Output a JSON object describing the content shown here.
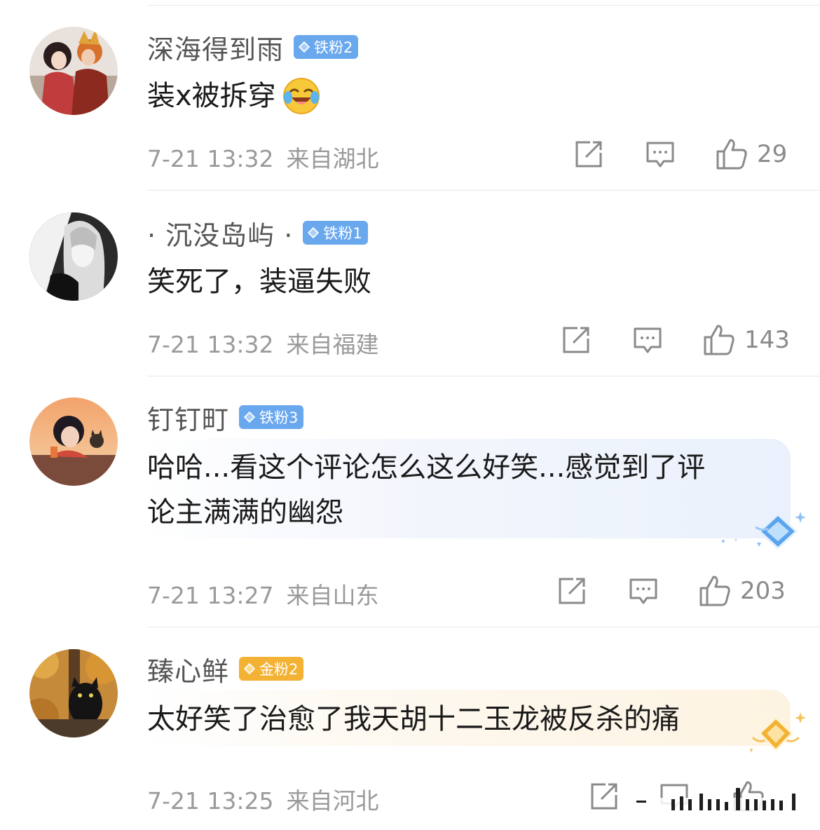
{
  "comments": [
    {
      "username": "深海得到雨",
      "badge": "铁粉2",
      "badge_type": "iron",
      "text": "装x被拆穿",
      "emoji": "laugh-cry-icon",
      "time": "7-21 13:32",
      "location": "来自湖北",
      "likes": "29"
    },
    {
      "username": "· 沉没岛屿 ·",
      "badge": "铁粉1",
      "badge_type": "iron",
      "text": "笑死了，装逼失败",
      "time": "7-21 13:32",
      "location": "来自福建",
      "likes": "143"
    },
    {
      "username": "钉钉町",
      "badge": "铁粉3",
      "badge_type": "iron",
      "text_line1": "哈哈...看这个评论怎么这么好笑...感觉到了评",
      "text_line2": "论主满满的幽怨",
      "time": "7-21 13:27",
      "location": "来自山东",
      "likes": "203"
    },
    {
      "username": "臻心鲜",
      "badge": "金粉2",
      "badge_type": "gold",
      "text": "太好笑了治愈了我天胡十二玉龙被反杀的痛",
      "time": "7-21 13:25",
      "location": "来自河北",
      "likes": ""
    }
  ],
  "colors": {
    "iron_badge": "#6aa8ee",
    "gold_badge": "#f3b233",
    "meta_text": "#9a9a9a"
  }
}
